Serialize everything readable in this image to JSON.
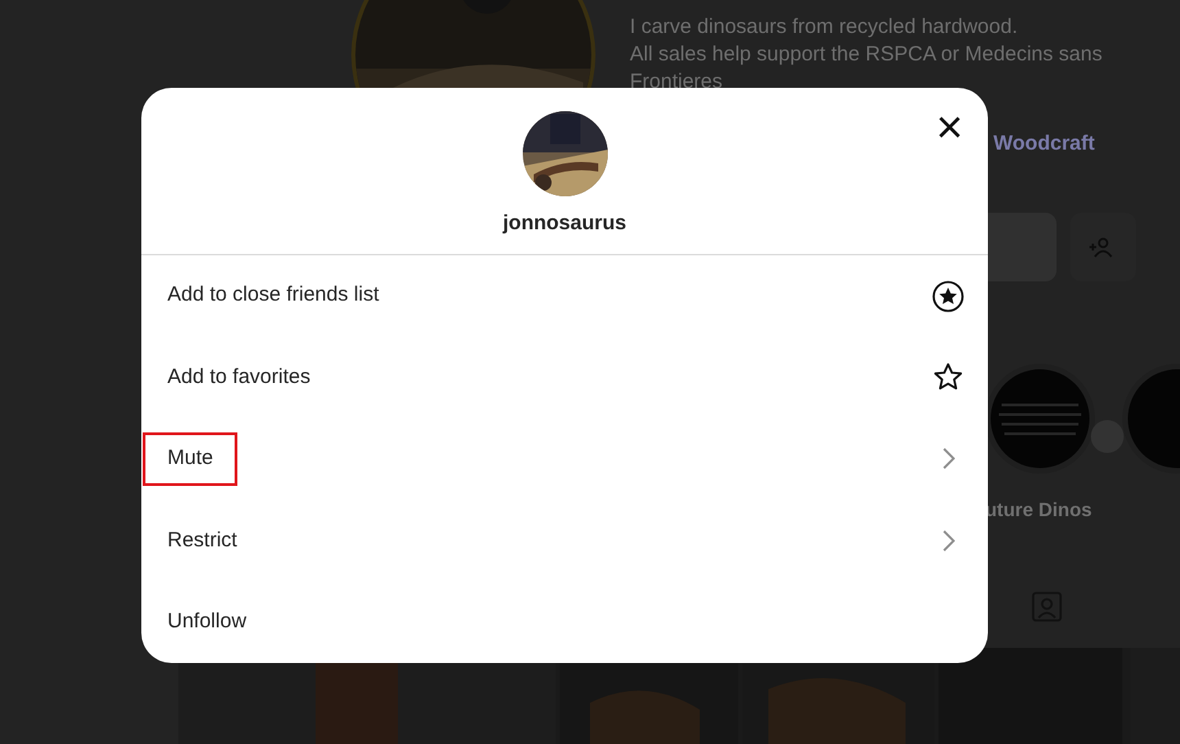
{
  "background": {
    "bio_lines": [
      "I carve dinosaurs from recycled hardwood.",
      "All sales help support the RSPCA or Medecins sans",
      "Frontieres"
    ],
    "hashtag": "Woodcraft",
    "highlight_label": "uture Dinos"
  },
  "dialog": {
    "username": "jonnosaurus",
    "close": "×",
    "items": [
      {
        "label": "Add to close friends list",
        "kind": "star-circle",
        "highlighted": false
      },
      {
        "label": "Add to favorites",
        "kind": "star",
        "highlighted": false
      },
      {
        "label": "Mute",
        "kind": "chevron",
        "highlighted": true
      },
      {
        "label": "Restrict",
        "kind": "chevron",
        "highlighted": false
      },
      {
        "label": "Unfollow",
        "kind": "none",
        "highlighted": false
      }
    ]
  }
}
